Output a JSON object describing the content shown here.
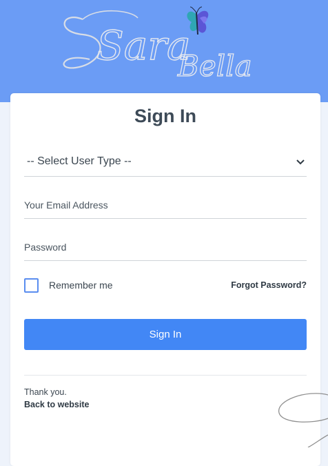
{
  "brand": {
    "logo_text_1": "Sara",
    "logo_text_2": "Bella",
    "header_color": "#6b9cf5"
  },
  "form": {
    "title": "Sign In",
    "user_type_selected": "-- Select User Type --",
    "email_placeholder": "Your Email Address",
    "password_placeholder": "Password",
    "remember_label": "Remember me",
    "remember_checked": false,
    "forgot_label": "Forgot Password?",
    "submit_label": "Sign In",
    "accent_color": "#4287f5"
  },
  "footer": {
    "thanks_text": "Thank you.",
    "back_label": "Back to website"
  },
  "icons": [
    "butterfly-icon",
    "chevron-down-icon"
  ]
}
